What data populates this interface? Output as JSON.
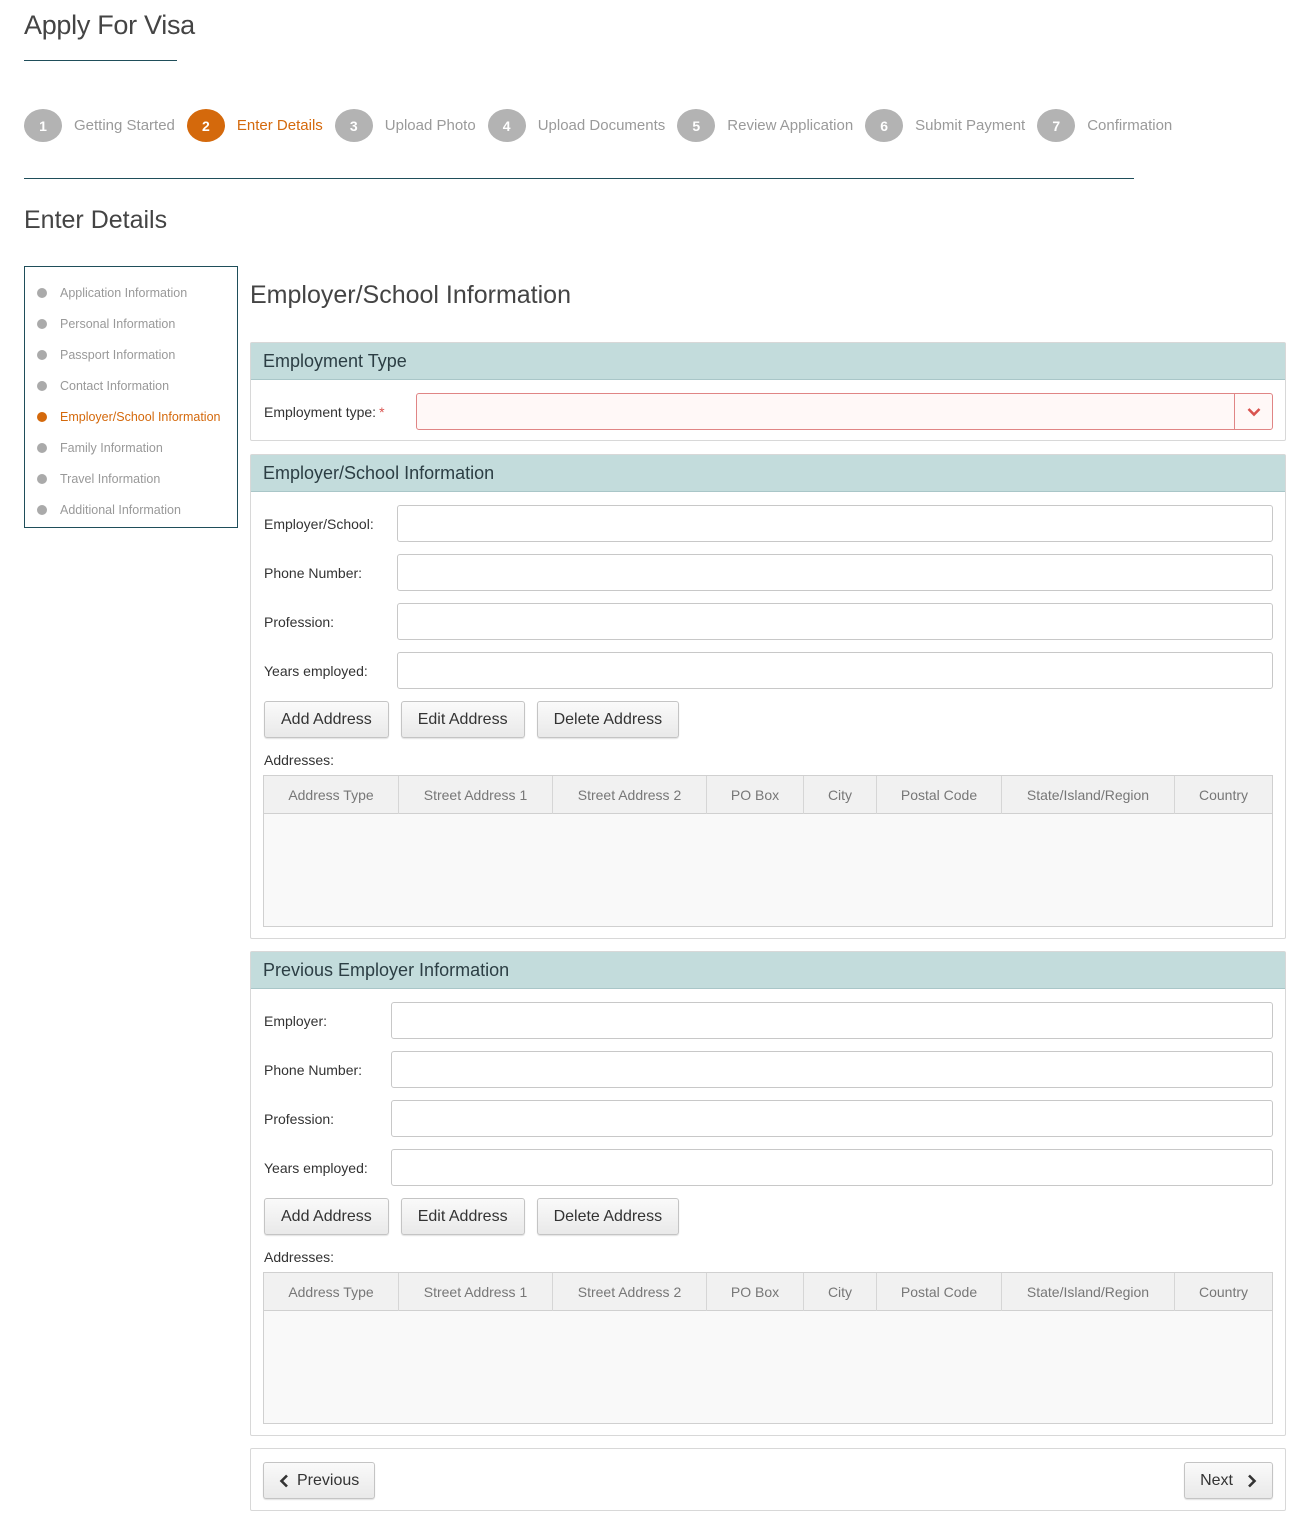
{
  "page": {
    "title": "Apply For Visa",
    "section_title": "Enter Details",
    "form_heading": "Employer/School Information"
  },
  "steps": [
    {
      "number": "1",
      "label": "Getting Started"
    },
    {
      "number": "2",
      "label": "Enter Details"
    },
    {
      "number": "3",
      "label": "Upload Photo"
    },
    {
      "number": "4",
      "label": "Upload Documents"
    },
    {
      "number": "5",
      "label": "Review Application"
    },
    {
      "number": "6",
      "label": "Submit Payment"
    },
    {
      "number": "7",
      "label": "Confirmation"
    }
  ],
  "sidenav": {
    "items": [
      {
        "label": "Application Information"
      },
      {
        "label": "Personal Information"
      },
      {
        "label": "Passport Information"
      },
      {
        "label": "Contact Information"
      },
      {
        "label": "Employer/School Information"
      },
      {
        "label": "Family Information"
      },
      {
        "label": "Travel Information"
      },
      {
        "label": "Additional Information"
      }
    ]
  },
  "employment_type": {
    "header": "Employment Type",
    "label": "Employment type:",
    "required_mark": "*",
    "value": ""
  },
  "employer_info": {
    "header": "Employer/School Information",
    "fields": [
      {
        "label": "Employer/School:",
        "value": ""
      },
      {
        "label": "Phone Number:",
        "value": ""
      },
      {
        "label": "Profession:",
        "value": ""
      },
      {
        "label": "Years employed:",
        "value": ""
      }
    ],
    "buttons": {
      "add": "Add Address",
      "edit": "Edit Address",
      "delete": "Delete Address"
    },
    "addresses_label": "Addresses:"
  },
  "previous_employer": {
    "header": "Previous Employer Information",
    "fields": [
      {
        "label": "Employer:",
        "value": ""
      },
      {
        "label": "Phone Number:",
        "value": ""
      },
      {
        "label": "Profession:",
        "value": ""
      },
      {
        "label": "Years employed:",
        "value": ""
      }
    ],
    "buttons": {
      "add": "Add Address",
      "edit": "Edit Address",
      "delete": "Delete Address"
    },
    "addresses_label": "Addresses:"
  },
  "address_columns": [
    "Address Type",
    "Street Address 1",
    "Street Address 2",
    "PO Box",
    "City",
    "Postal Code",
    "State/Island/Region",
    "Country"
  ],
  "navigation": {
    "previous": "Previous",
    "next": "Next"
  },
  "colors": {
    "accent": "#d4690c",
    "header_bg": "#c3dcdc",
    "line": "#1f4e5a",
    "error_border": "#e08585"
  }
}
